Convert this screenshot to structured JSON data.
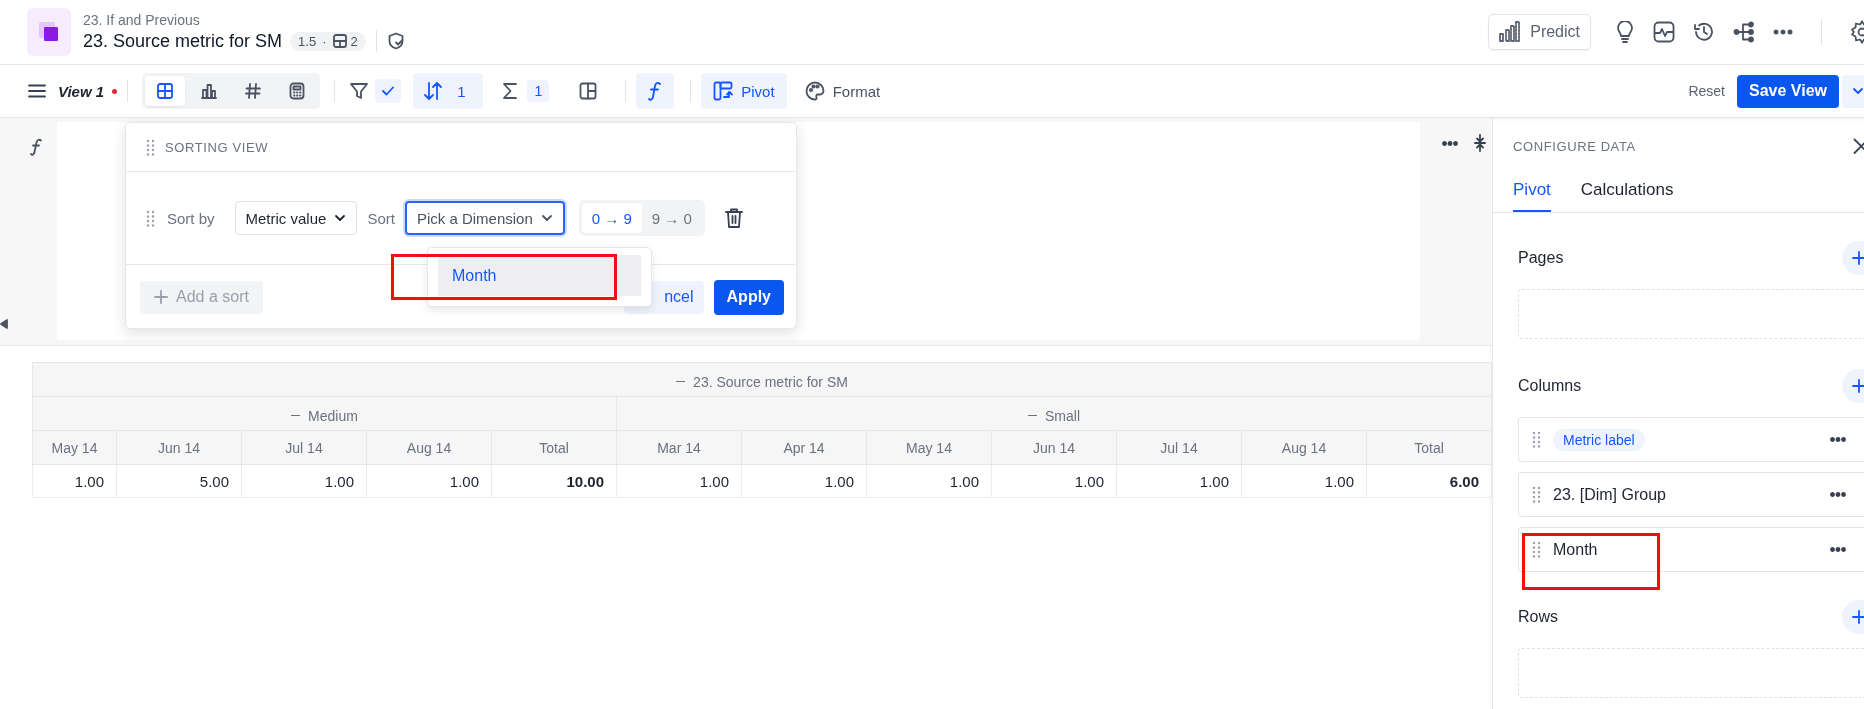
{
  "header": {
    "breadcrumb": "23. If and Previous",
    "title": "23. Source metric for SM",
    "version": "1.5",
    "separator": "·",
    "views_count": "2"
  },
  "header_actions": {
    "predict": "Predict"
  },
  "toolbar": {
    "view_name": "View 1",
    "unsaved": true,
    "view_types": [
      {
        "kind": "table",
        "selected": true
      },
      {
        "kind": "bar",
        "selected": false
      },
      {
        "kind": "number",
        "selected": false
      },
      {
        "kind": "calc",
        "selected": false
      }
    ],
    "tools": [
      {
        "kind": "filter",
        "checked": true
      },
      {
        "kind": "sort",
        "count": "1",
        "active": true
      },
      {
        "kind": "sum",
        "count": "1",
        "active": false
      },
      {
        "kind": "layout",
        "active": false
      },
      {
        "kind": "formula",
        "active": true
      },
      {
        "kind": "pivot",
        "label": "Pivot",
        "active": true
      },
      {
        "kind": "format",
        "label": "Format",
        "active": false
      }
    ],
    "reset": "Reset",
    "save": "Save View"
  },
  "sorting_popup": {
    "title": "SORTING VIEW",
    "rules": [
      {
        "label": "Sort by",
        "field": "Metric value",
        "sort_label": "Sort",
        "dimension_placeholder": "Pick a Dimension",
        "directions": [
          {
            "label": "0 → 9",
            "selected": true
          },
          {
            "label": "9 → 0",
            "selected": false
          }
        ]
      }
    ],
    "add_sort": "Add a sort",
    "cancel": "ncel",
    "apply": "Apply",
    "dropdown": {
      "options": [
        {
          "label": "Month",
          "highlighted": true,
          "annotated": true
        }
      ]
    }
  },
  "table": {
    "title": "23. Source metric for SM",
    "groups": [
      {
        "label": "Medium",
        "columns": [
          {
            "label": "May 14",
            "value": "1.00",
            "kind": "month"
          },
          {
            "label": "Jun 14",
            "value": "5.00",
            "kind": "month"
          },
          {
            "label": "Jul 14",
            "value": "1.00",
            "kind": "month"
          },
          {
            "label": "Aug 14",
            "value": "1.00",
            "kind": "month"
          },
          {
            "label": "Total",
            "value": "10.00",
            "kind": "total"
          }
        ]
      },
      {
        "label": "Small",
        "columns": [
          {
            "label": "Mar 14",
            "value": "1.00",
            "kind": "month"
          },
          {
            "label": "Apr 14",
            "value": "1.00",
            "kind": "month"
          },
          {
            "label": "May 14",
            "value": "1.00",
            "kind": "month"
          },
          {
            "label": "Jun 14",
            "value": "1.00",
            "kind": "month"
          },
          {
            "label": "Jul 14",
            "value": "1.00",
            "kind": "month"
          },
          {
            "label": "Aug 14",
            "value": "1.00",
            "kind": "month"
          },
          {
            "label": "Total",
            "value": "6.00",
            "kind": "total"
          }
        ]
      }
    ]
  },
  "config_panel": {
    "title": "CONFIGURE DATA",
    "tabs": [
      {
        "label": "Pivot",
        "selected": true
      },
      {
        "label": "Calculations",
        "selected": false
      }
    ],
    "sections": [
      {
        "title": "Pages"
      },
      {
        "title": "Columns",
        "items": [
          {
            "label": "Metric label",
            "kind": "chip",
            "annotated": false
          },
          {
            "label": "23. [Dim] Group",
            "kind": "plain",
            "annotated": false
          },
          {
            "label": "Month",
            "kind": "plain",
            "annotated": true
          }
        ]
      },
      {
        "title": "Rows"
      }
    ]
  }
}
